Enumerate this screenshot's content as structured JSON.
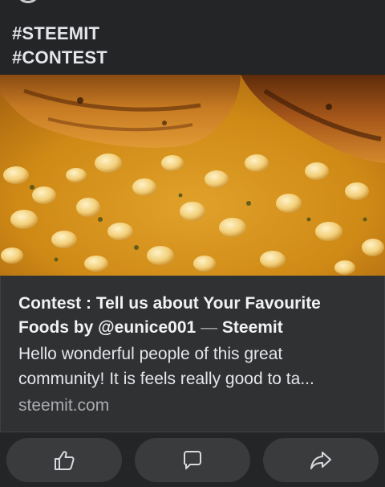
{
  "post": {
    "hashtags": [
      "#STEEMIT",
      "#CONTEST"
    ]
  },
  "link_preview": {
    "title_main": "Contest : Tell us about Your Favourite Foods by @eunice001",
    "title_separator": "—",
    "title_site": "Steemit",
    "description_lines": [
      "Hello wonderful people of this great",
      "community! It is feels really good to ta..."
    ],
    "domain": "steemit.com",
    "image_icon": "food-photo-beans-plantain"
  },
  "actions": {
    "like_icon": "thumbs-up-icon",
    "comment_icon": "comment-icon",
    "share_icon": "share-icon"
  },
  "colors": {
    "background": "#242526",
    "card_background": "#303132",
    "button_background": "#3a3b3c",
    "text_primary": "#e4e6eb",
    "text_secondary": "#a8abaf"
  }
}
